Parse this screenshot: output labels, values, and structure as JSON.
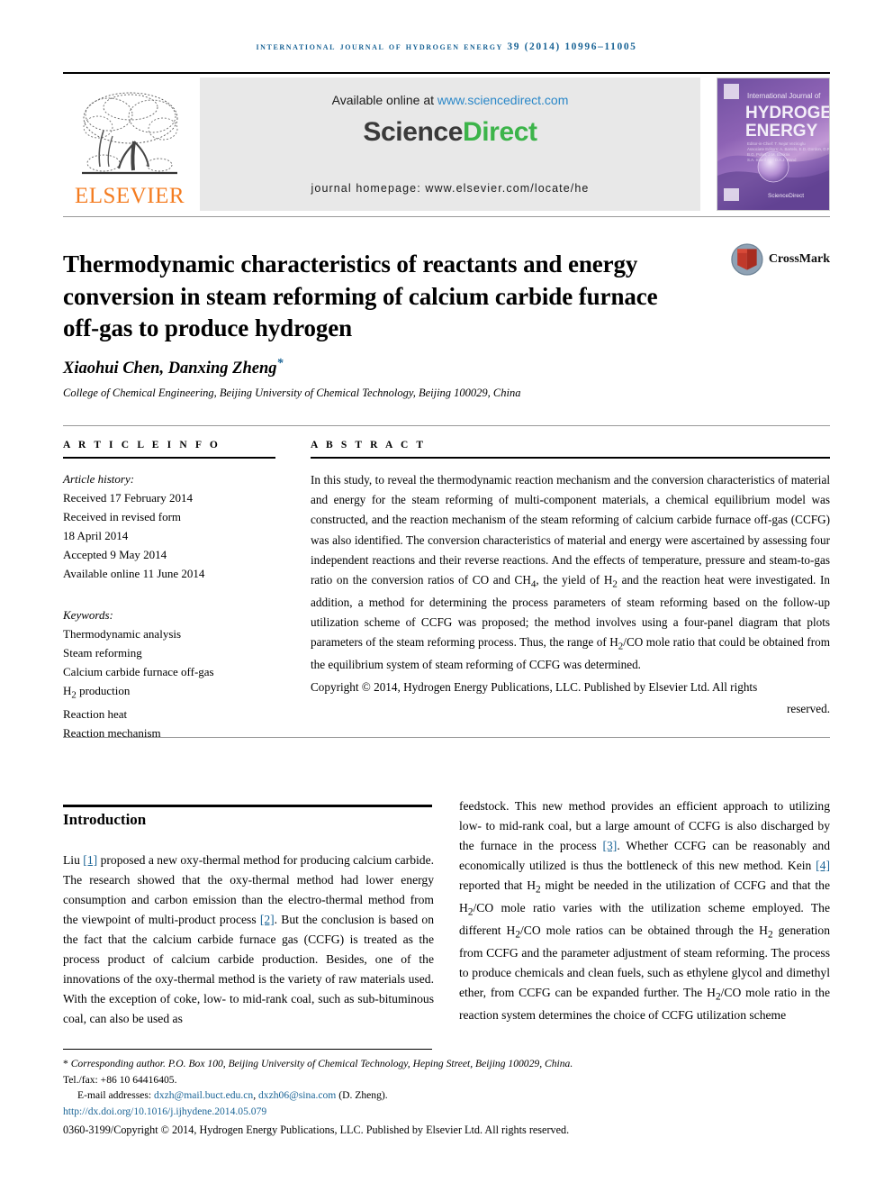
{
  "running_head": "International Journal of Hydrogen Energy 39 (2014) 10996–11005",
  "masthead": {
    "publisher_name": "ELSEVIER",
    "available_prefix": "Available online at ",
    "available_url": "www.sciencedirect.com",
    "logo_part1": "Science",
    "logo_part2": "Direct",
    "journal_homepage": "journal homepage: www.elsevier.com/locate/he",
    "cover": {
      "line1": "International Journal of",
      "line2": "HYDROGEN",
      "line3": "ENERGY",
      "footer": "ScienceDirect"
    }
  },
  "crossmark": {
    "label": "CrossMark"
  },
  "article": {
    "title": "Thermodynamic characteristics of reactants and energy conversion in steam reforming of calcium carbide furnace off-gas to produce hydrogen",
    "authors": "Xiaohui Chen, Danxing Zheng",
    "corresponding_marker": "*",
    "affiliation": "College of Chemical Engineering, Beijing University of Chemical Technology, Beijing 100029, China"
  },
  "article_info": {
    "heading": "A R T I C L E  I N F O",
    "history_label": "Article history:",
    "history": [
      "Received 17 February 2014",
      "Received in revised form",
      "18 April 2014",
      "Accepted 9 May 2014",
      "Available online 11 June 2014"
    ],
    "keywords_label": "Keywords:",
    "keywords": [
      "Thermodynamic analysis",
      "Steam reforming",
      "Calcium carbide furnace off-gas",
      "H2 production",
      "Reaction heat",
      "Reaction mechanism"
    ]
  },
  "abstract": {
    "heading": "A B S T R A C T",
    "text": "In this study, to reveal the thermodynamic reaction mechanism and the conversion characteristics of material and energy for the steam reforming of multi-component materials, a chemical equilibrium model was constructed, and the reaction mechanism of the steam reforming of calcium carbide furnace off-gas (CCFG) was also identified. The conversion characteristics of material and energy were ascertained by assessing four independent reactions and their reverse reactions. And the effects of temperature, pressure and steam-to-gas ratio on the conversion ratios of CO and CH4, the yield of H2 and the reaction heat were investigated. In addition, a method for determining the process parameters of steam reforming based on the follow-up utilization scheme of CCFG was proposed; the method involves using a four-panel diagram that plots parameters of the steam reforming process. Thus, the range of H2/CO mole ratio that could be obtained from the equilibrium system of steam reforming of CCFG was determined.",
    "copyright": "Copyright © 2014, Hydrogen Energy Publications, LLC. Published by Elsevier Ltd. All rights",
    "copyright_tail": "reserved."
  },
  "body": {
    "section_heading": "Introduction",
    "left_p1_a": "Liu ",
    "left_cite1": "[1]",
    "left_p1_b": " proposed a new oxy-thermal method for producing calcium carbide. The research showed that the oxy-thermal method had lower energy consumption and carbon emission than the electro-thermal method from the viewpoint of multi-product process ",
    "left_cite2": "[2]",
    "left_p1_c": ". But the conclusion is based on the fact that the calcium carbide furnace gas (CCFG) is treated as the process product of calcium carbide production. Besides, one of the innovations of the oxy-thermal method is the variety of raw materials used. With the exception of coke, low- to mid-rank coal, such as sub-bituminous coal, can also be used as",
    "right_p1_a": "feedstock. This new method provides an efficient approach to utilizing low- to mid-rank coal, but a large amount of CCFG is also discharged by the furnace in the process ",
    "right_cite3": "[3]",
    "right_p1_b": ". Whether CCFG can be reasonably and economically utilized is thus the bottleneck of this new method. Kein ",
    "right_cite4": "[4]",
    "right_p1_c": " reported that H2 might be needed in the utilization of CCFG and that the H2/CO mole ratio varies with the utilization scheme employed. The different H2/CO mole ratios can be obtained through the H2 generation from CCFG and the parameter adjustment of steam reforming. The process to produce chemicals and clean fuels, such as ethylene glycol and dimethyl ether, from CCFG can be expanded further. The H2/CO mole ratio in the reaction system determines the choice of CCFG utilization scheme"
  },
  "footer": {
    "corresponding": "Corresponding author. P.O. Box 100, Beijing University of Chemical Technology, Heping Street, Beijing 100029, China.",
    "telfax": "Tel./fax: +86 10 64416405.",
    "email_label": "E-mail addresses:",
    "email1": "dxzh@mail.buct.edu.cn",
    "email2": "dxzh06@sina.com",
    "email_attrib": "(D. Zheng).",
    "doi": "http://dx.doi.org/10.1016/j.ijhydene.2014.05.079",
    "issn_line": "0360-3199/Copyright © 2014, Hydrogen Energy Publications, LLC. Published by Elsevier Ltd. All rights reserved."
  },
  "colors": {
    "link": "#1a6496",
    "sciencedirect_green": "#3cb44a",
    "elsevier_orange": "#f47c20",
    "banner_bg": "#e8e8e8"
  }
}
